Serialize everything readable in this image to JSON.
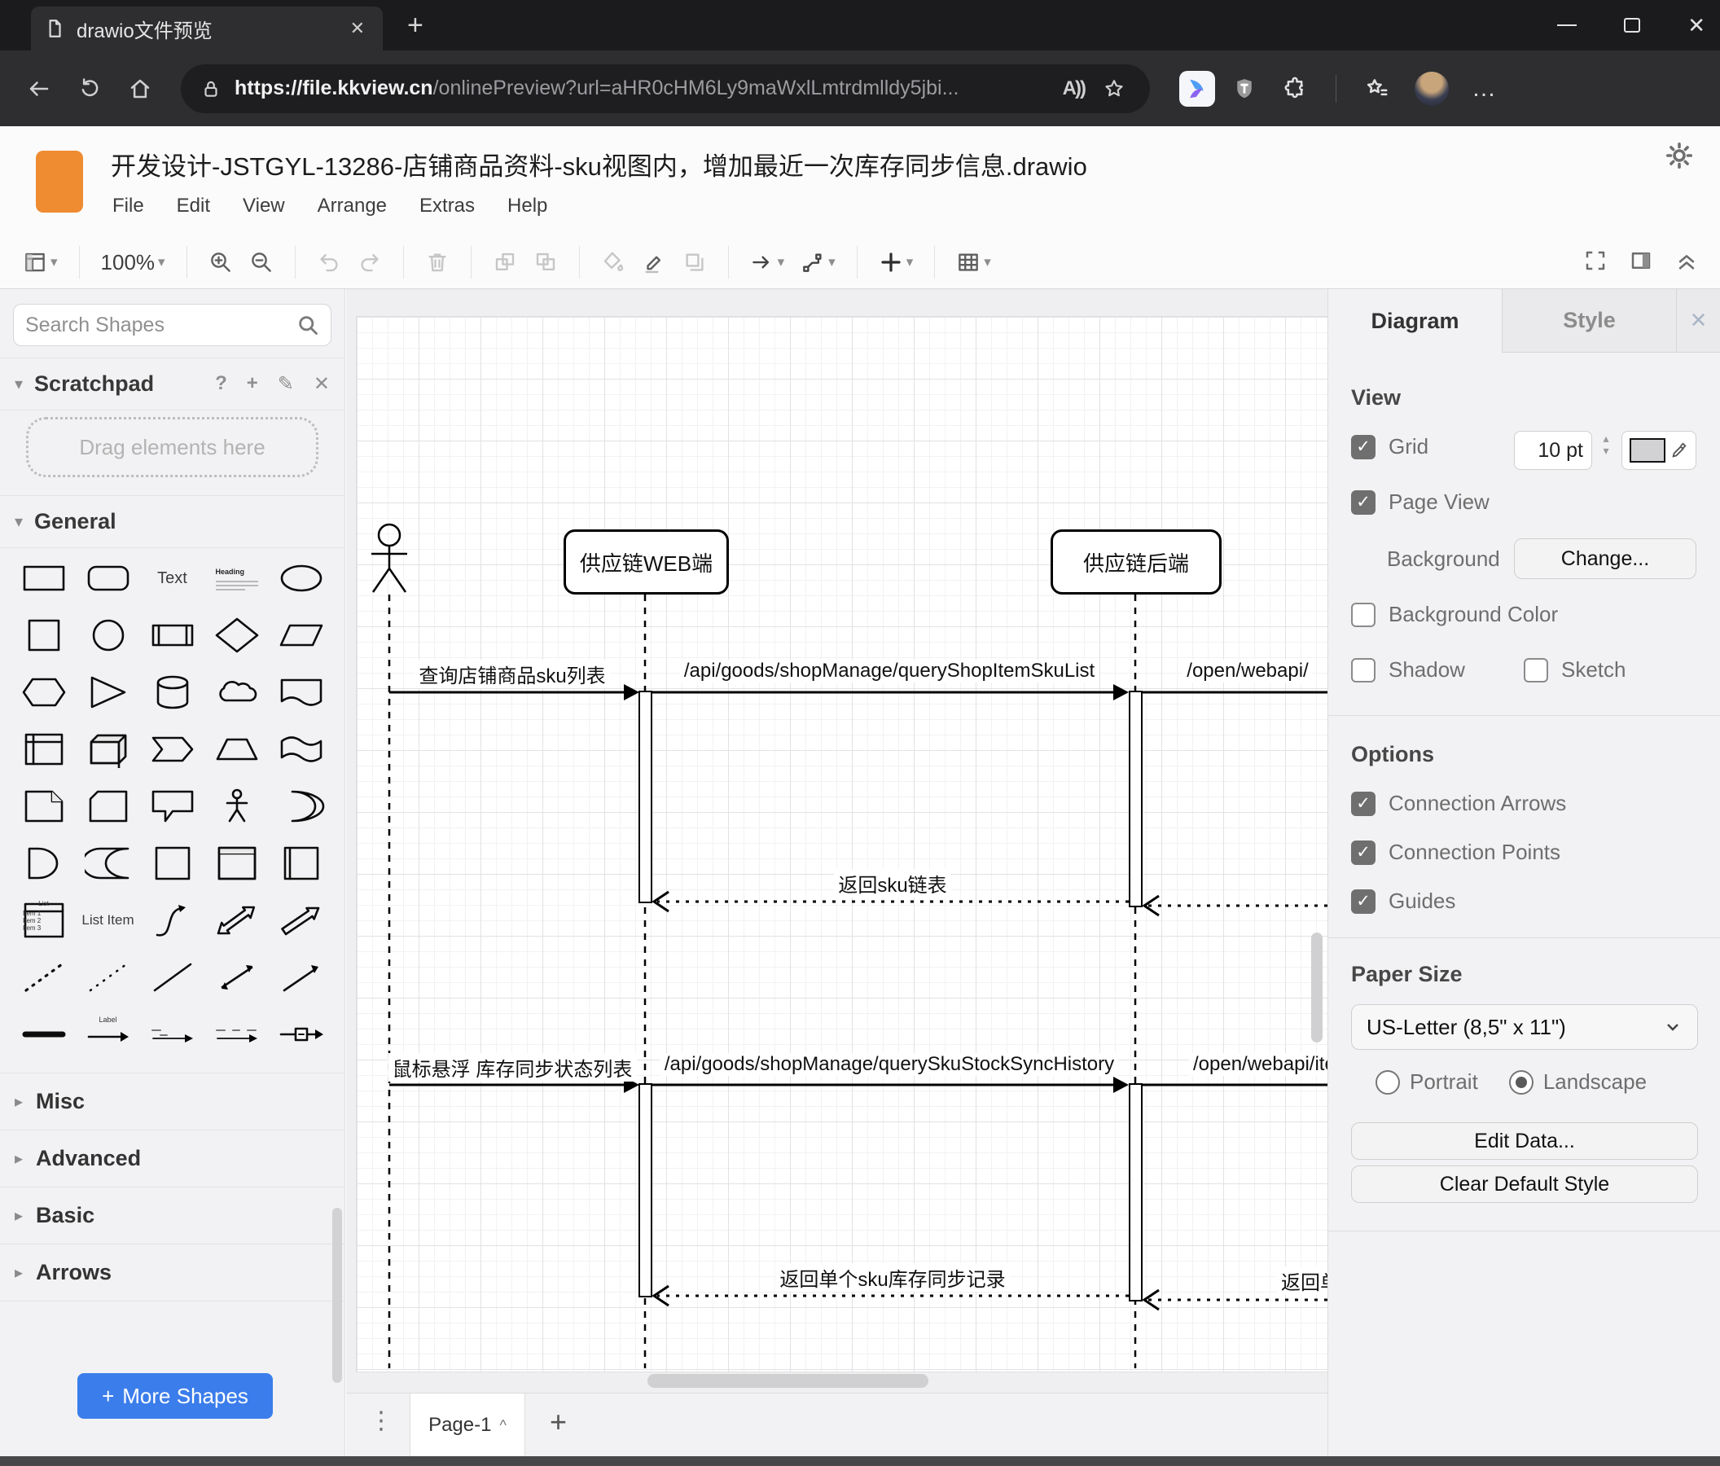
{
  "icons": {
    "check": "✓",
    "close": "✕",
    "plus": "+",
    "question": "?",
    "edit": "✎",
    "caret_down": "▾",
    "caret_right": "▸",
    "spin_up": "▴",
    "spin_down": "▾",
    "dots_v": "⋮",
    "dots_h": "…",
    "page_caret": "^",
    "read_aloud": "A))"
  },
  "browser": {
    "tab_title": "drawio文件预览",
    "url_host": "https://file.kkview.cn",
    "url_path": "/onlinePreview?url=aHR0cHM6Ly9maWxlLmtrdmlldy5jbi..."
  },
  "app": {
    "title": "开发设计-JSTGYL-13286-店铺商品资料-sku视图内，增加最近一次库存同步信息.drawio",
    "menus": [
      "File",
      "Edit",
      "View",
      "Arrange",
      "Extras",
      "Help"
    ],
    "zoom": "100%"
  },
  "sidebar": {
    "search_placeholder": "Search Shapes",
    "scratchpad_title": "Scratchpad",
    "scratchpad_hint": "Drag elements here",
    "sections": {
      "general": "General",
      "misc": "Misc",
      "advanced": "Advanced",
      "basic": "Basic",
      "arrows": "Arrows"
    },
    "shapes": {
      "text": "Text",
      "heading": "Heading",
      "list_title": "List",
      "item1": "Item 1",
      "item2": "Item 2",
      "item3": "Item 3",
      "list_item": "List Item",
      "label": "Label"
    },
    "more_shapes_label": "More Shapes"
  },
  "canvas": {
    "participants": {
      "web": "供应链WEB端",
      "backend": "供应链后端"
    },
    "messages": {
      "query_sku_list": "查询店铺商品sku列表",
      "api_query_shop_item_sku_list": "/api/goods/shopManage/queryShopItemSkuList",
      "open_webapi_1": "/open/webapi/",
      "return_sku_list": "返回sku链表",
      "hover_sync_list": "鼠标悬浮 库存同步状态列表",
      "api_query_sku_stock_sync_history": "/api/goods/shopManage/querySkuStockSyncHistory",
      "open_webapi_2": "/open/webapi/item",
      "return_single_sku": "返回单个sku库存同步记录",
      "return_right": "返回单个sku库存同步记录"
    }
  },
  "footer": {
    "page_tab": "Page-1"
  },
  "panel": {
    "tab_diagram": "Diagram",
    "tab_style": "Style",
    "view": {
      "heading": "View",
      "grid": "Grid",
      "grid_size": "10 pt",
      "page_view": "Page View",
      "background": "Background",
      "change": "Change...",
      "background_color": "Background Color",
      "shadow": "Shadow",
      "sketch": "Sketch"
    },
    "options": {
      "heading": "Options",
      "connection_arrows": "Connection Arrows",
      "connection_points": "Connection Points",
      "guides": "Guides"
    },
    "paper": {
      "heading": "Paper Size",
      "size": "US-Letter (8,5\" x 11\")",
      "portrait": "Portrait",
      "landscape": "Landscape"
    },
    "edit_data": "Edit Data...",
    "clear_default_style": "Clear Default Style"
  },
  "colors": {
    "accent_blue": "#3b7deb",
    "logo_orange": "#ef8b31",
    "chrome_dark": "#2e2e30"
  }
}
